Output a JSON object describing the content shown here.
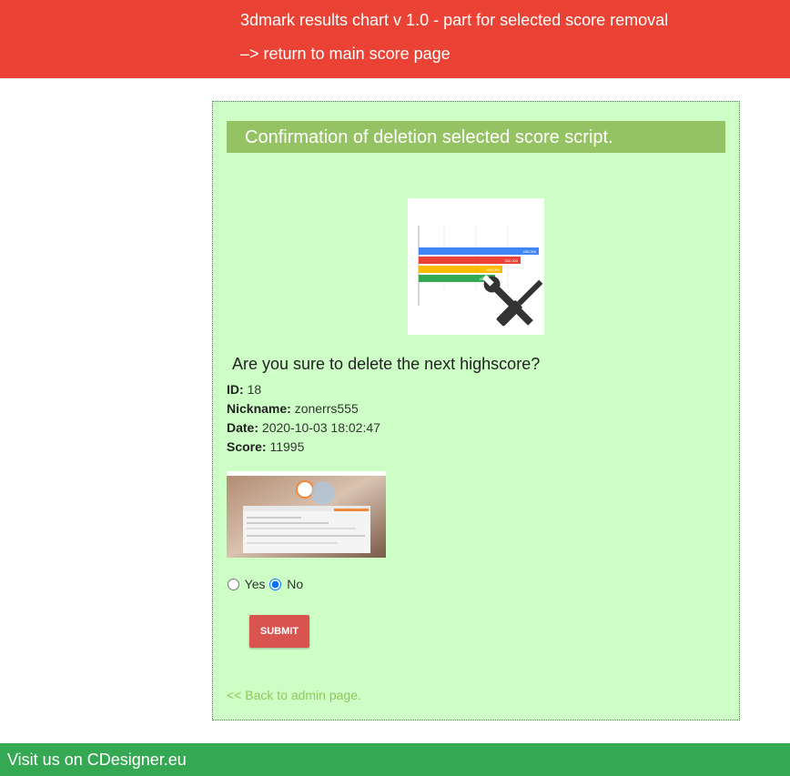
{
  "header": {
    "title": "3dmark results chart v 1.0 - part for selected score removal",
    "return_link": "–> return to main score page"
  },
  "panel": {
    "heading": "Confirmation of deletion selected score script.",
    "question": "Are you sure to delete the next highscore?"
  },
  "logo_bars": {
    "labels": [
      "465,000",
      "332,000",
      "450,000",
      "415,000"
    ],
    "colors": [
      "#4285f4",
      "#ea4335",
      "#fbbc05",
      "#34a853"
    ]
  },
  "score": {
    "id_label": "ID:",
    "id_value": "18",
    "nickname_label": "Nickname:",
    "nickname_value": "zonerrs555",
    "date_label": "Date:",
    "date_value": "2020-10-03 18:02:47",
    "score_label": "Score:",
    "score_value": "11995"
  },
  "options": {
    "yes_label": "Yes",
    "no_label": "No",
    "selected": "No"
  },
  "submit_label": "SUBMIT",
  "back_link": "<< Back to admin page.",
  "footer": {
    "text": "Visit us on CDesigner.eu"
  },
  "colors": {
    "header_bg": "#ea4335",
    "panel_bg": "#cdfec6",
    "heading_bg": "#95c262",
    "submit_bg": "#d9534f",
    "footer_bg": "#34a853",
    "link": "#8ec85a"
  }
}
